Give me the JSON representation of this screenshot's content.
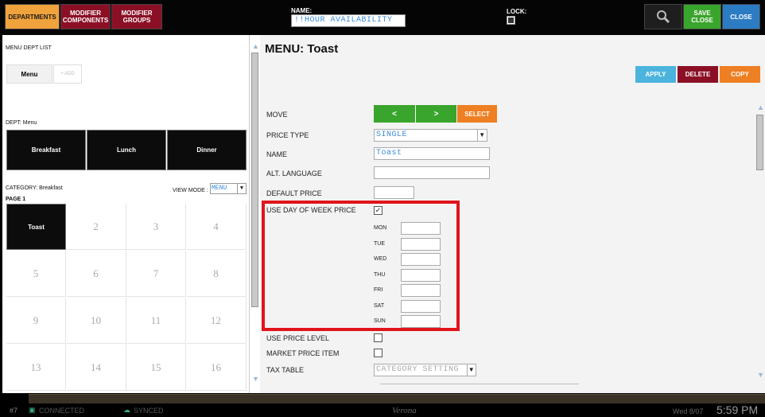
{
  "top": {
    "departments": "DEPARTMENTS",
    "modifier_components": "MODIFIER COMPONENTS",
    "modifier_groups": "MODIFIER GROUPS",
    "name_label": "NAME:",
    "name_value": "!!HOUR AVAILABILITY",
    "lock_label": "LOCK:",
    "save_close": "SAVE CLOSE",
    "close": "CLOSE",
    "colors": {
      "departments": "#f0a23c",
      "modifier": "#8b1026",
      "save": "#3aa52c",
      "close": "#2c7cc4"
    }
  },
  "left": {
    "menu_dept_list": "MENU DEPT LIST",
    "menu_tab": "Menu",
    "add": "+ ADD",
    "dept_label": "DEPT: Menu",
    "depts": [
      "Breakfast",
      "Lunch",
      "Dinner"
    ],
    "category_label": "CATEGORY: Breakfast",
    "view_mode_label": "VIEW MODE :",
    "view_mode_value": "MENU",
    "page_label": "PAGE 1",
    "cells": [
      "Toast",
      "2",
      "3",
      "4",
      "5",
      "6",
      "7",
      "8",
      "9",
      "10",
      "11",
      "12",
      "13",
      "14",
      "15",
      "16"
    ]
  },
  "right": {
    "title": "MENU: Toast",
    "apply": "APPLY",
    "delete": "DELETE",
    "copy": "COPY",
    "move_label": "MOVE",
    "move_left": "<",
    "move_right": ">",
    "select": "SELECT",
    "price_type_label": "PRICE TYPE",
    "price_type_value": "SINGLE",
    "name_label": "NAME",
    "name_value": "Toast",
    "alt_language_label": "ALT. LANGUAGE",
    "default_price_label": "DEFAULT PRICE",
    "use_dow_label": "USE DAY OF WEEK PRICE",
    "use_dow_checked": "✓",
    "days": [
      "MON",
      "TUE",
      "WED",
      "THU",
      "FRI",
      "SAT",
      "SUN"
    ],
    "use_price_level_label": "USE PRICE LEVEL",
    "market_price_label": "MARKET PRICE ITEM",
    "tax_table_label": "TAX TABLE",
    "tax_table_value": "CATEGORY SETTING"
  },
  "status": {
    "terminal": "#7",
    "connected": "CONNECTED",
    "synced": "SYNCED",
    "location": "Verona",
    "date": "Wed 8/07",
    "time": "5:59 PM"
  }
}
